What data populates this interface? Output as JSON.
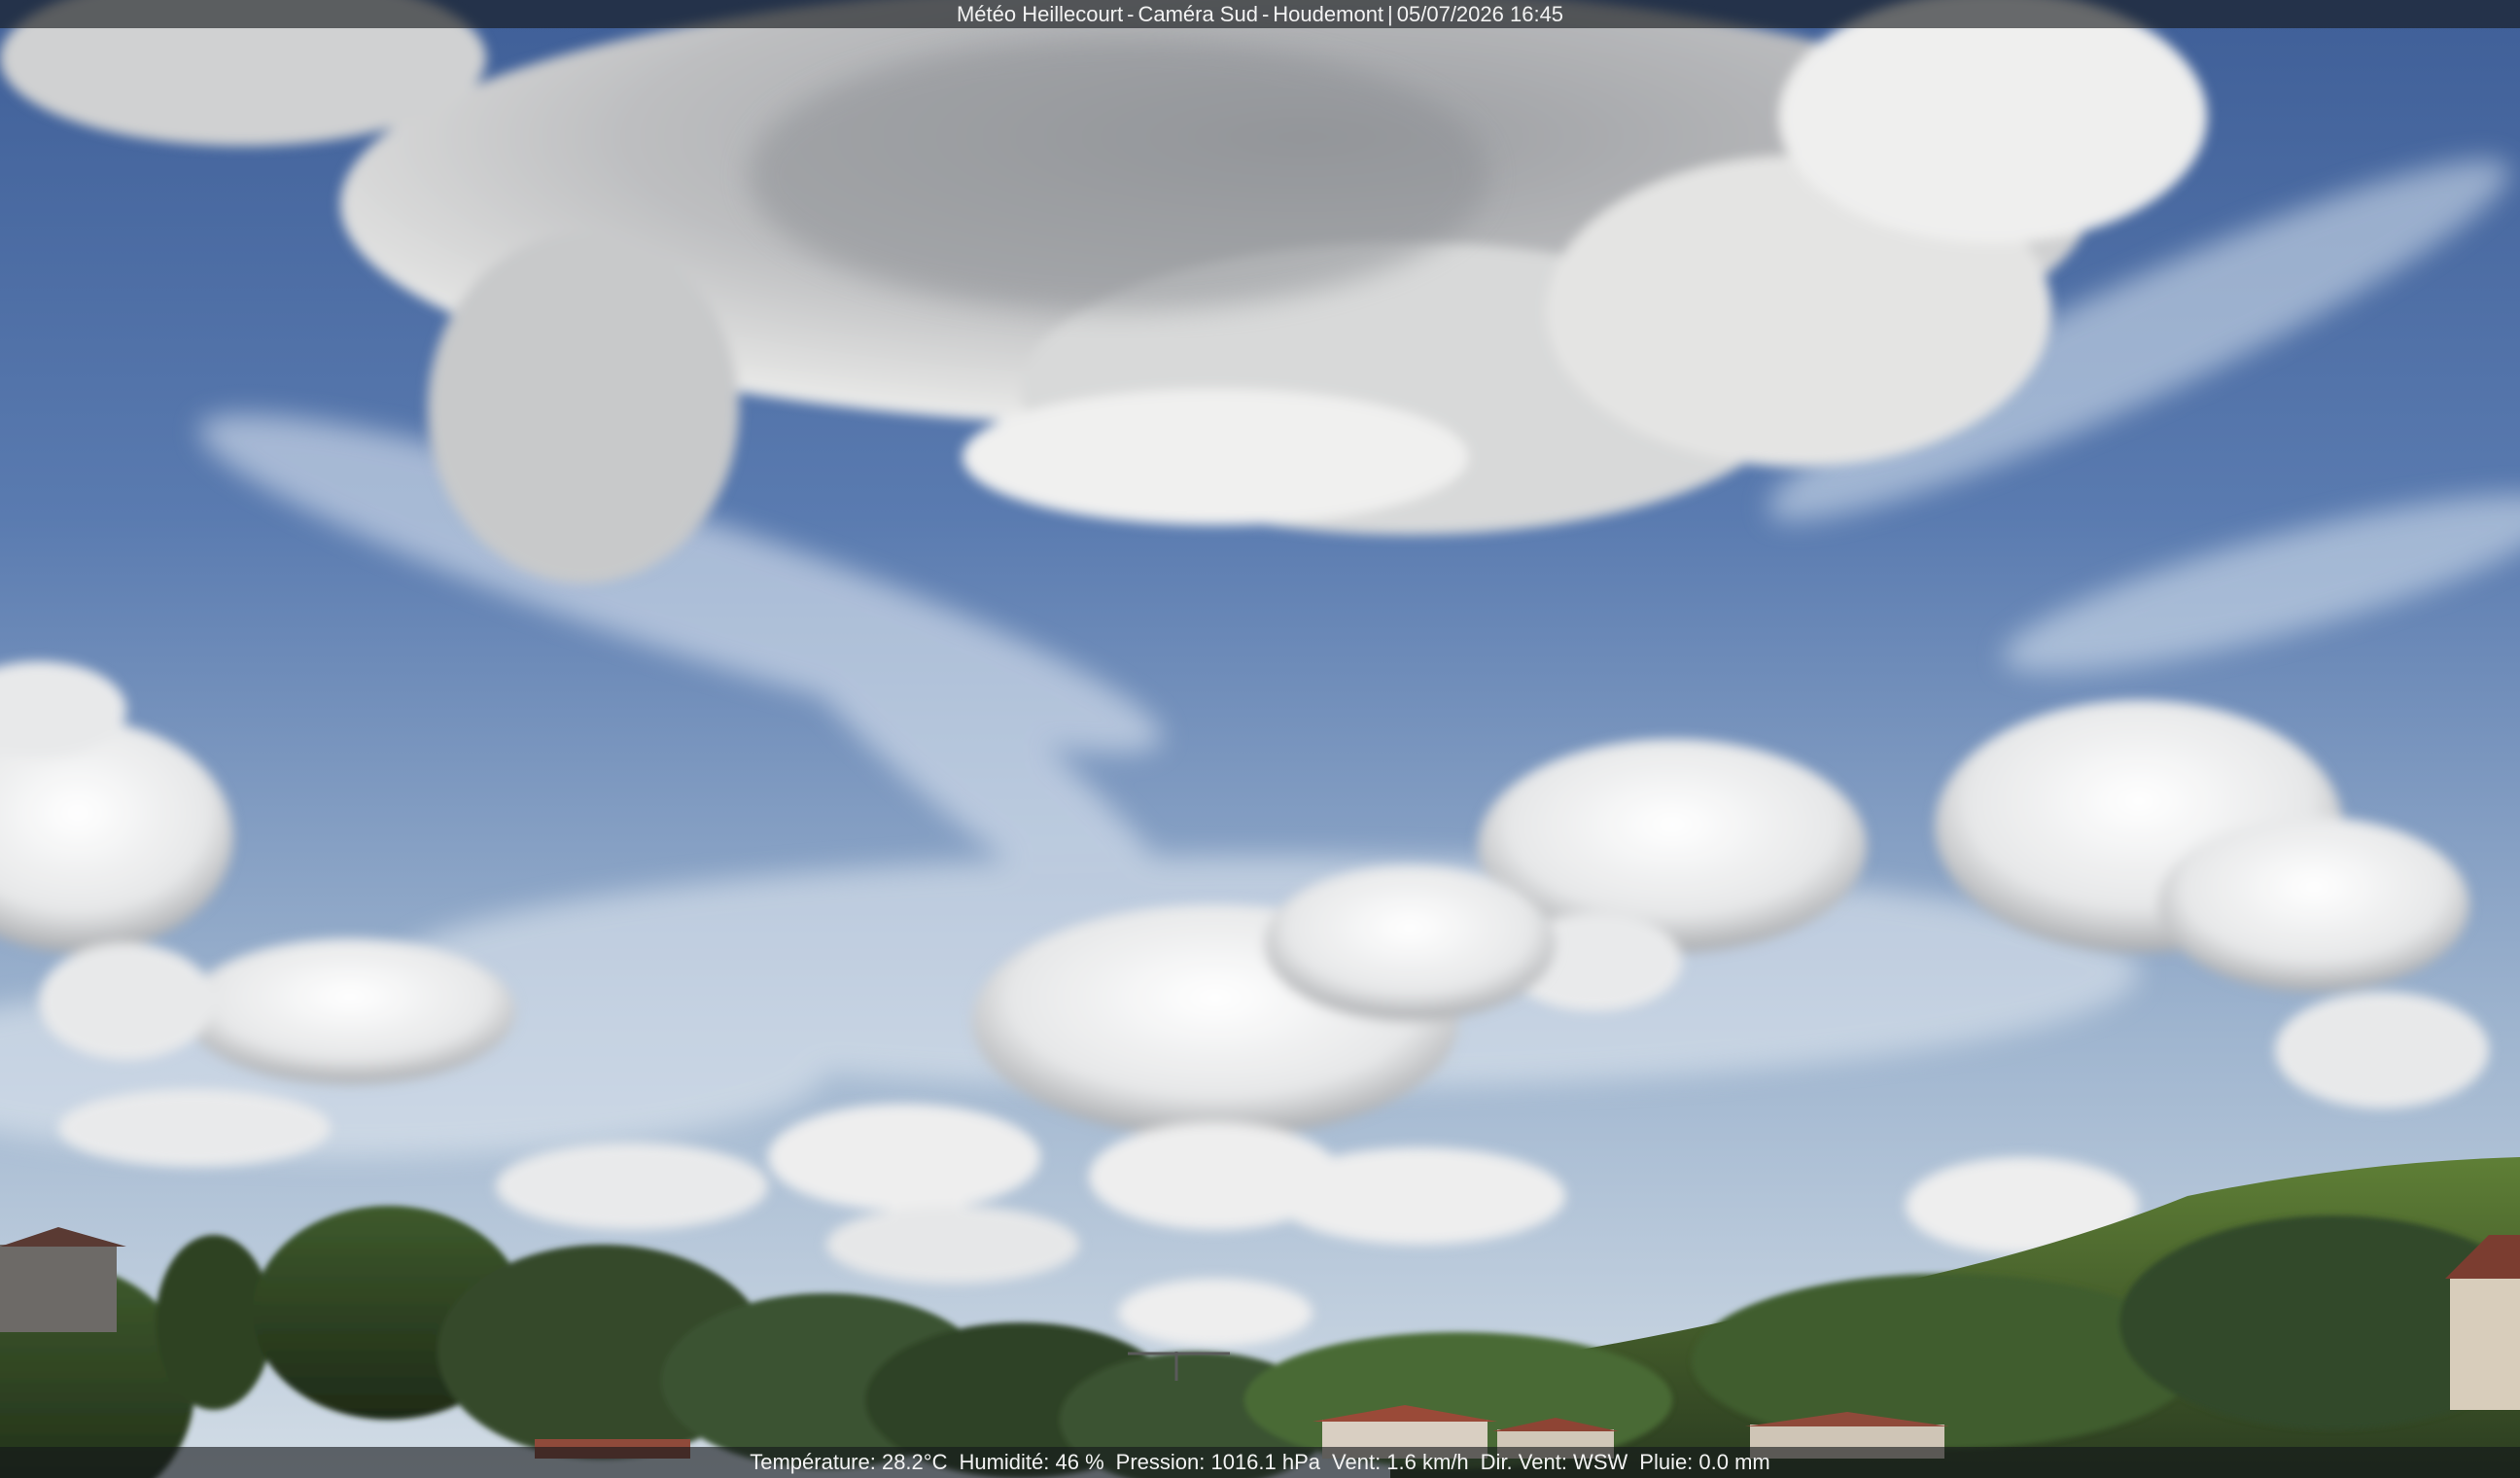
{
  "overlay": {
    "top": {
      "station": "Météo Heillecourt",
      "camera": "Caméra Sud",
      "location": "Houdemont",
      "datetime": "05/07/2026 16:45"
    },
    "bottom": {
      "temperature": "Température: 28.2°C",
      "humidity": "Humidité: 46 %",
      "pressure": "Pression: 1016.1 hPa",
      "wind": "Vent: 1.6 km/h",
      "wind_dir": "Dir. Vent: WSW",
      "rain": "Pluie: 0.0 mm"
    }
  },
  "colors": {
    "sky_top": "#4f6fa6",
    "sky_horizon": "#c9d6e3",
    "cloud_light": "#f4f4f2",
    "cloud_shadow": "#8a8c90",
    "trees_dark": "#2b3d22",
    "trees_light": "#5e7d35",
    "roof": "#9a4a38"
  }
}
